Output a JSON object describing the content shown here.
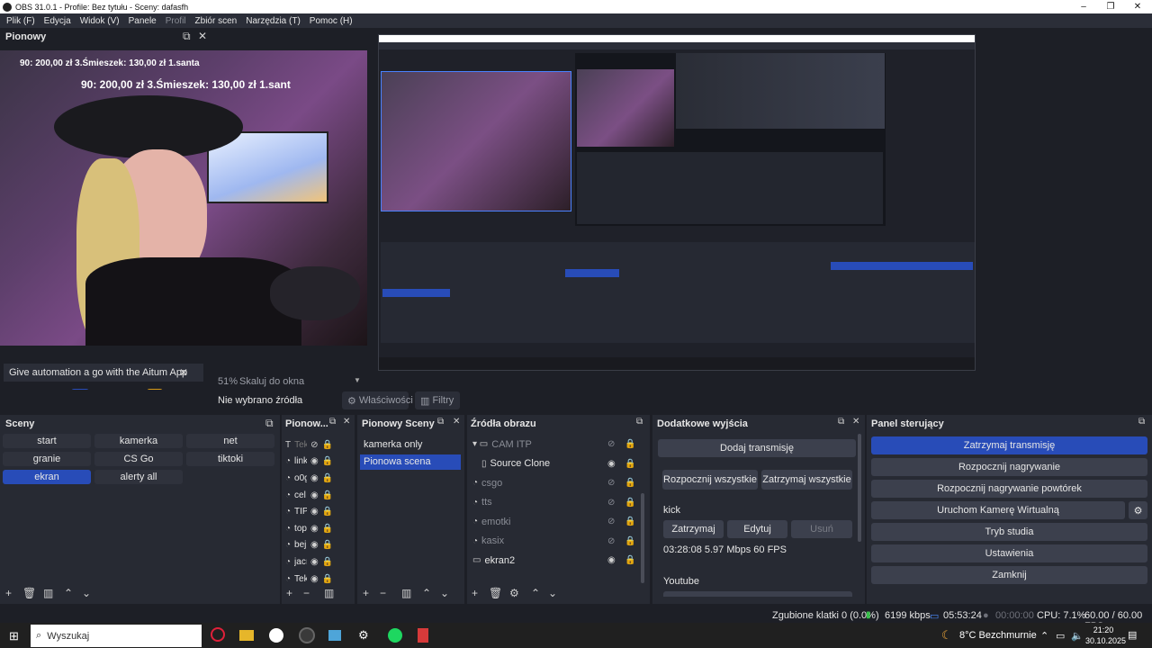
{
  "window": {
    "title": "OBS 31.0.1 - Profile: Bez tytułu - Sceny: dafasfh"
  },
  "menu": [
    {
      "label": "Plik (F)",
      "enabled": true
    },
    {
      "label": "Edycja",
      "enabled": true
    },
    {
      "label": "Widok (V)",
      "enabled": true
    },
    {
      "label": "Panele",
      "enabled": true
    },
    {
      "label": "Profil",
      "enabled": false
    },
    {
      "label": "Zbiór scen",
      "enabled": true
    },
    {
      "label": "Narzędzia (T)",
      "enabled": true
    },
    {
      "label": "Pomoc (H)",
      "enabled": true
    }
  ],
  "vertical_dock": {
    "title": "Pionowy",
    "overlay_text_small": "90: 200,00 zł 3.Śmieszek: 130,00 zł 1.santa",
    "overlay_text": "90: 200,00 zł 3.Śmieszek: 130,00 zł 1.sant",
    "aitum_banner": "Give automation a go with the Aitum App"
  },
  "preview": {
    "zoom_percent": "51%",
    "scale_label": "Skaluj do okna"
  },
  "source_bar": {
    "no_source": "Nie wybrano źródła",
    "properties": "Właściwości",
    "filters": "Filtry"
  },
  "scenes_dock": {
    "title": "Sceny",
    "scenes": [
      "start",
      "kamerka",
      "net",
      "granie",
      "CS Go",
      "tiktoki",
      "ekran",
      "alerty all"
    ],
    "selected": "ekran"
  },
  "vertical_sources_dock": {
    "title": "Pionow...",
    "items": [
      "Tek",
      "link",
      "o0g",
      "cel",
      "TIP",
      "top",
      "bej",
      "jacı",
      "Tek"
    ]
  },
  "vertical_scenes_dock": {
    "title": "Pionowy Sceny",
    "scenes": [
      "kamerka only",
      "Pionowa scena"
    ],
    "selected": "Pionowa scena"
  },
  "sources_dock": {
    "title": "Źródła obrazu",
    "items": [
      {
        "name": "CAM ITP",
        "type": "folder",
        "indent": 0,
        "visible": false
      },
      {
        "name": "Source Clone",
        "type": "file",
        "indent": 1,
        "visible": true
      },
      {
        "name": "csgo",
        "type": "media",
        "indent": 0,
        "visible": false
      },
      {
        "name": "tts",
        "type": "media",
        "indent": 0,
        "visible": false
      },
      {
        "name": "emotki",
        "type": "media",
        "indent": 0,
        "visible": false
      },
      {
        "name": "kasix",
        "type": "media",
        "indent": 0,
        "visible": false
      },
      {
        "name": "ekran2",
        "type": "display",
        "indent": 0,
        "visible": true
      }
    ]
  },
  "outputs_dock": {
    "title": "Dodatkowe wyjścia",
    "add_stream": "Dodaj transmisję",
    "start_all": "Rozpocznij wszystkie",
    "stop_all": "Zatrzymaj wszystkie",
    "output1_name": "kick",
    "stop": "Zatrzymaj",
    "edit": "Edytuj",
    "remove": "Usuń",
    "output1_stats": "03:28:08  5.97 Mbps  60 FPS",
    "output2_name": "Youtube"
  },
  "controls_dock": {
    "title": "Panel sterujący",
    "buttons": [
      "Zatrzymaj transmisję",
      "Rozpocznij nagrywanie",
      "Rozpocznij nagrywanie powtórek",
      "Uruchom Kamerę Wirtualną",
      "Tryb studia",
      "Ustawienia",
      "Zamknij"
    ]
  },
  "status_bar": {
    "dropped": "Zgubione klatki 0 (0.0%)",
    "bitrate": "6199 kbps",
    "stream_time": "05:53:24",
    "rec_time": "00:00:00",
    "cpu": "CPU: 7.1%",
    "fps": "60.00 / 60.00 FPS"
  },
  "taskbar": {
    "search_placeholder": "Wyszukaj",
    "weather": "8°C  Bezchmurnie",
    "time": "21:20",
    "date": "30.10.2025"
  },
  "colors": {
    "accent": "#284cb8",
    "background": "#1d1f26",
    "panel": "#272a33",
    "button": "#3c404d",
    "alert_text": "#a682ff"
  }
}
